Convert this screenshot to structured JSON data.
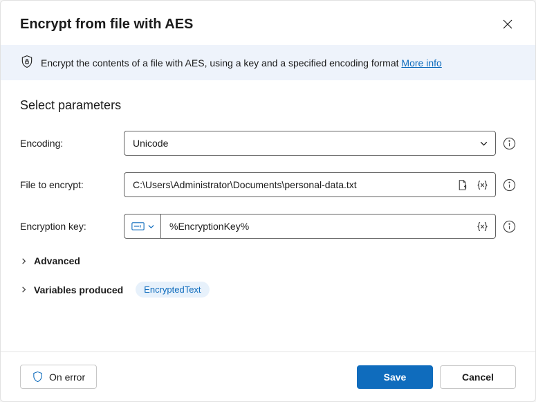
{
  "header": {
    "title": "Encrypt from file with AES"
  },
  "banner": {
    "text": "Encrypt the contents of a file with AES, using a key and a specified encoding format ",
    "link_text": "More info"
  },
  "section_title": "Select parameters",
  "params": {
    "encoding": {
      "label": "Encoding:",
      "value": "Unicode"
    },
    "file": {
      "label": "File to encrypt:",
      "value": "C:\\Users\\Administrator\\Documents\\personal-data.txt"
    },
    "key": {
      "label": "Encryption key:",
      "value": "%EncryptionKey%"
    }
  },
  "expanders": {
    "advanced": "Advanced",
    "variables_produced": "Variables produced"
  },
  "variable_chip": "EncryptedText",
  "footer": {
    "on_error": "On error",
    "save": "Save",
    "cancel": "Cancel"
  }
}
